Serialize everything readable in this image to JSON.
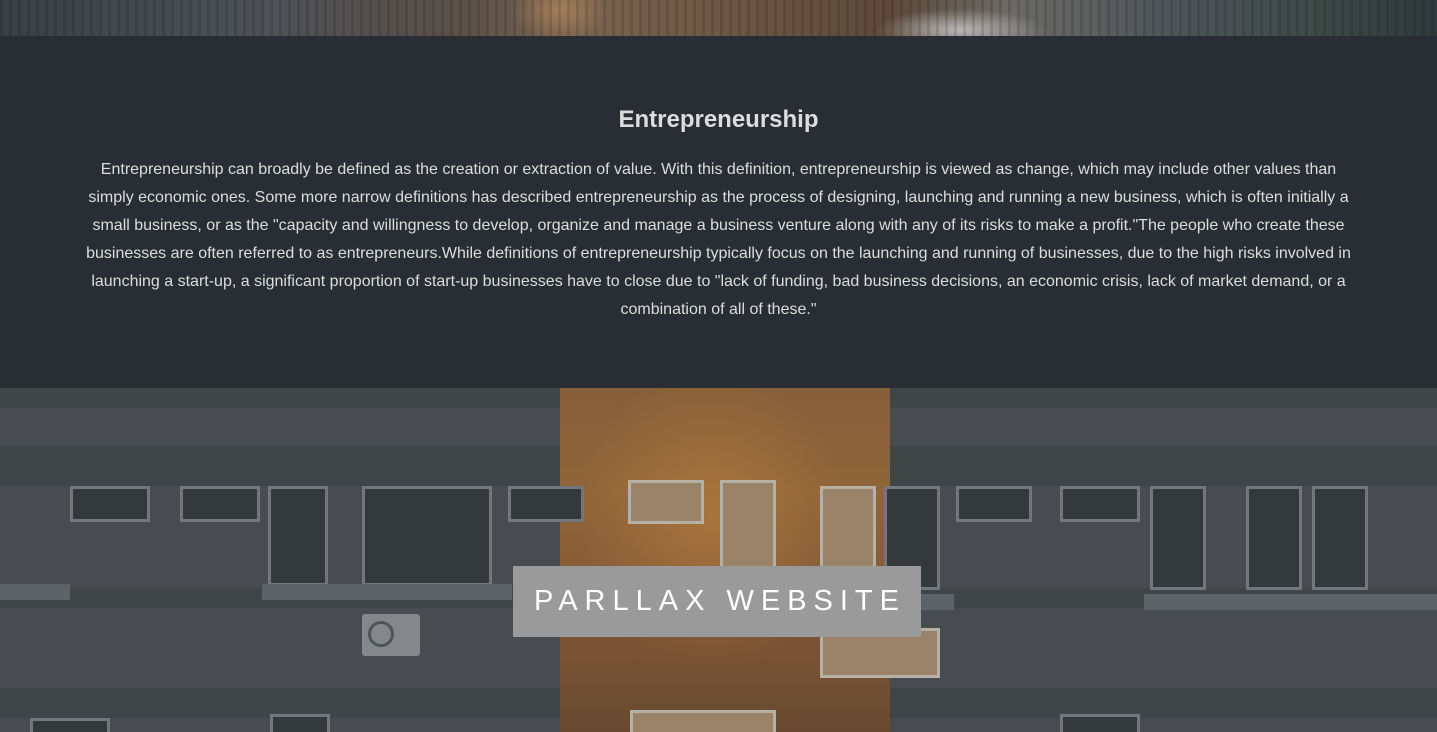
{
  "section": {
    "title": "Entrepreneurship",
    "body": "Entrepreneurship can broadly be defined as the creation or extraction of value. With this definition, entrepreneurship is viewed as change, which may include other values than simply economic ones. Some more narrow definitions has described entrepreneurship as the process of designing, launching and running a new business, which is often initially a small business, or as the \"capacity and willingness to develop, organize and manage a business venture along with any of its risks to make a profit.\"The people who create these businesses are often referred to as entrepreneurs.While definitions of entrepreneurship typically focus on the launching and running of businesses, due to the high risks involved in launching a start-up, a significant proportion of start-up businesses have to close due to \"lack of funding, bad business decisions, an economic crisis, lack of market demand, or a combination of all of these.\""
  },
  "hero": {
    "label": "PARLLAX WEBSITE"
  },
  "colors": {
    "section_background": "#282e34",
    "text": "#dddddd",
    "label_background": "#9a9a9a",
    "label_text": "#ffffff"
  }
}
